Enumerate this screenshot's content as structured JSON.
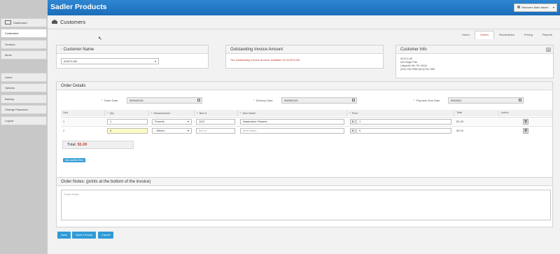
{
  "app": {
    "brand": "Sadler Products"
  },
  "user": {
    "label": "Welcome Main Admin"
  },
  "sidebar": {
    "items": [
      {
        "label": "Dashboard"
      },
      {
        "label": "Customers"
      },
      {
        "label": "Vendors"
      },
      {
        "label": "Items"
      },
      {
        "label": "Users"
      },
      {
        "label": "Options"
      },
      {
        "label": "Backup"
      },
      {
        "label": "Change Password"
      },
      {
        "label": "Logout"
      }
    ]
  },
  "page": {
    "title": "Customers"
  },
  "tabs": [
    "Home",
    "Orders",
    "Receivables",
    "Pricing",
    "Reports"
  ],
  "customer_name": {
    "label": "Customer Name",
    "value": "ACECLUB"
  },
  "outstanding": {
    "title": "Outstanding Invoice Amount",
    "message": "*No outstanding invoice amount available for ACECLUB."
  },
  "customer_info": {
    "title": "Customer Info",
    "lines": [
      "ACECLUB",
      "600 Ridge Pike",
      "Lafayette Hill, PA 19444",
      "(610) 238-9988 (610)726-7489"
    ]
  },
  "order_details": {
    "title": "Order Details",
    "order_date": {
      "label": "Order Date",
      "value": "05/04/2021"
    },
    "delivery_date": {
      "label": "Delivery Date",
      "value": "05/05/2021"
    },
    "payment_due": {
      "label": "Payment Due Date",
      "value": "5/5/2021"
    },
    "columns": [
      "Seq",
      "Qty",
      "Measurement",
      "Item #",
      "Item Name",
      "Price",
      "Total",
      "Action"
    ],
    "rows": [
      {
        "seq": "1",
        "qty": "1",
        "measurement": "Pounds",
        "item_no": "1112",
        "item_name": "Nasturtium Flowers",
        "currency": "$",
        "price": "1",
        "total": "$1.00",
        "action": "🗑"
      },
      {
        "seq": "2",
        "qty": "0",
        "measurement": "- Select -",
        "item_no": "Item #",
        "item_name": "Item Name",
        "currency": "$",
        "price": "0",
        "total": "$0.00",
        "action": "🗑"
      }
    ],
    "total_label": "Total:",
    "total_value": "$1.00",
    "add_button": "Add another item"
  },
  "notes": {
    "title": "Order Notes: (prints at the bottom of the invoice)",
    "placeholder": "Order Notes"
  },
  "buttons": {
    "save": "Save",
    "save_email": "Save & Email",
    "cancel": "Cancel"
  },
  "colors": {
    "topbar": "#1f73bf",
    "accent_red": "#c0392b",
    "button_blue": "#2e9bd6"
  }
}
